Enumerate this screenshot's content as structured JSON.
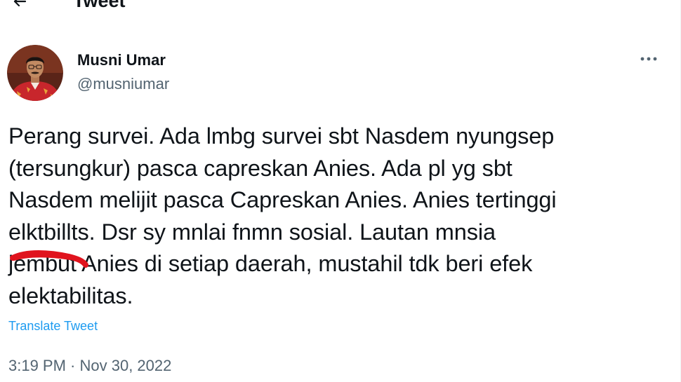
{
  "header": {
    "back_icon": "arrow-left-icon",
    "title": "Tweet"
  },
  "author": {
    "avatar_icon": "profile-photo",
    "name": "Musni Umar",
    "handle": "@musniumar"
  },
  "more_icon": "more-horizontal-icon",
  "tweet": {
    "lines": [
      "Perang survei. Ada lmbg survei sbt  Nasdem nyungsep",
      "(tersungkur) pasca capreskan Anies. Ada pl yg sbt",
      "Nasdem melijit pasca Capreskan Anies. Anies tertinggi",
      "elktbillts. Dsr sy mnlai fnmn sosial. Lautan mnsia",
      "jembut Anies di setiap  daerah, mustahil tdk beri efek",
      "elektabilitas."
    ]
  },
  "translate_label": "Translate Tweet",
  "timestamp": "3:19 PM · Nov 30, 2022",
  "colors": {
    "link": "#1d9bf0",
    "secondary_text": "#536471",
    "annotation_red": "#e0141e"
  }
}
